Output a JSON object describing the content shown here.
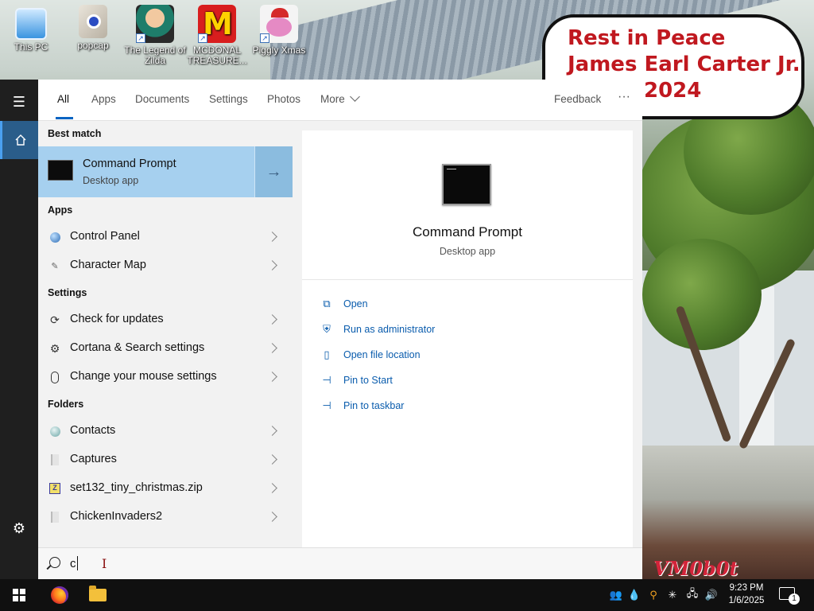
{
  "desktop": {
    "icons": [
      {
        "label": "This PC",
        "icon": "computer-icon"
      },
      {
        "label": "popcap",
        "icon": "installer-icon"
      },
      {
        "label": "The Legend of Zilda",
        "icon": "game-character-icon"
      },
      {
        "label": "MCDONAL TREASURE...",
        "icon": "mcdonalds-logo-icon"
      },
      {
        "label": "Piggly Xmas",
        "icon": "pig-icon"
      }
    ],
    "bubble_lines": [
      "Rest in Peace",
      "James Earl Carter Jr.",
      "2024"
    ],
    "watermark": "VM0b0t"
  },
  "rail": {
    "menu_icon": "hamburger-icon",
    "home_icon": "home-icon",
    "settings_icon": "gear-icon"
  },
  "tabs": {
    "items": [
      "All",
      "Apps",
      "Documents",
      "Settings",
      "Photos",
      "More"
    ],
    "feedback": "Feedback",
    "ellipsis": "···"
  },
  "results": {
    "best_match_header": "Best match",
    "best_match": {
      "title": "Command Prompt",
      "subtitle": "Desktop app"
    },
    "apps_header": "Apps",
    "apps": [
      {
        "label": "Control Panel",
        "icon": "control-panel-icon"
      },
      {
        "label": "Character Map",
        "icon": "character-map-icon"
      }
    ],
    "settings_header": "Settings",
    "settings": [
      {
        "label": "Check for updates",
        "icon": "refresh-icon"
      },
      {
        "label": "Cortana & Search settings",
        "icon": "gear-icon"
      },
      {
        "label": "Change your mouse settings",
        "icon": "mouse-icon"
      }
    ],
    "folders_header": "Folders",
    "folders": [
      {
        "label": "Contacts",
        "icon": "contacts-icon"
      },
      {
        "label": "Captures",
        "icon": "folder-icon"
      },
      {
        "label": "set132_tiny_christmas.zip",
        "icon": "zip-icon"
      },
      {
        "label": "ChickenInvaders2",
        "icon": "folder-icon"
      }
    ]
  },
  "preview": {
    "title": "Command Prompt",
    "subtitle": "Desktop app",
    "actions": [
      {
        "label": "Open",
        "icon": "open-icon"
      },
      {
        "label": "Run as administrator",
        "icon": "run-as-admin-icon"
      },
      {
        "label": "Open file location",
        "icon": "file-location-icon"
      },
      {
        "label": "Pin to Start",
        "icon": "pin-icon"
      },
      {
        "label": "Pin to taskbar",
        "icon": "pin-icon"
      }
    ]
  },
  "search": {
    "query": "c"
  },
  "taskbar": {
    "time": "9:23 PM",
    "date": "1/6/2025",
    "notification_count": "1"
  },
  "colors": {
    "accent": "#0a64c2",
    "best_match_bg": "#a6d0ef",
    "link": "#0a5cad",
    "taskbar": "#101010"
  }
}
